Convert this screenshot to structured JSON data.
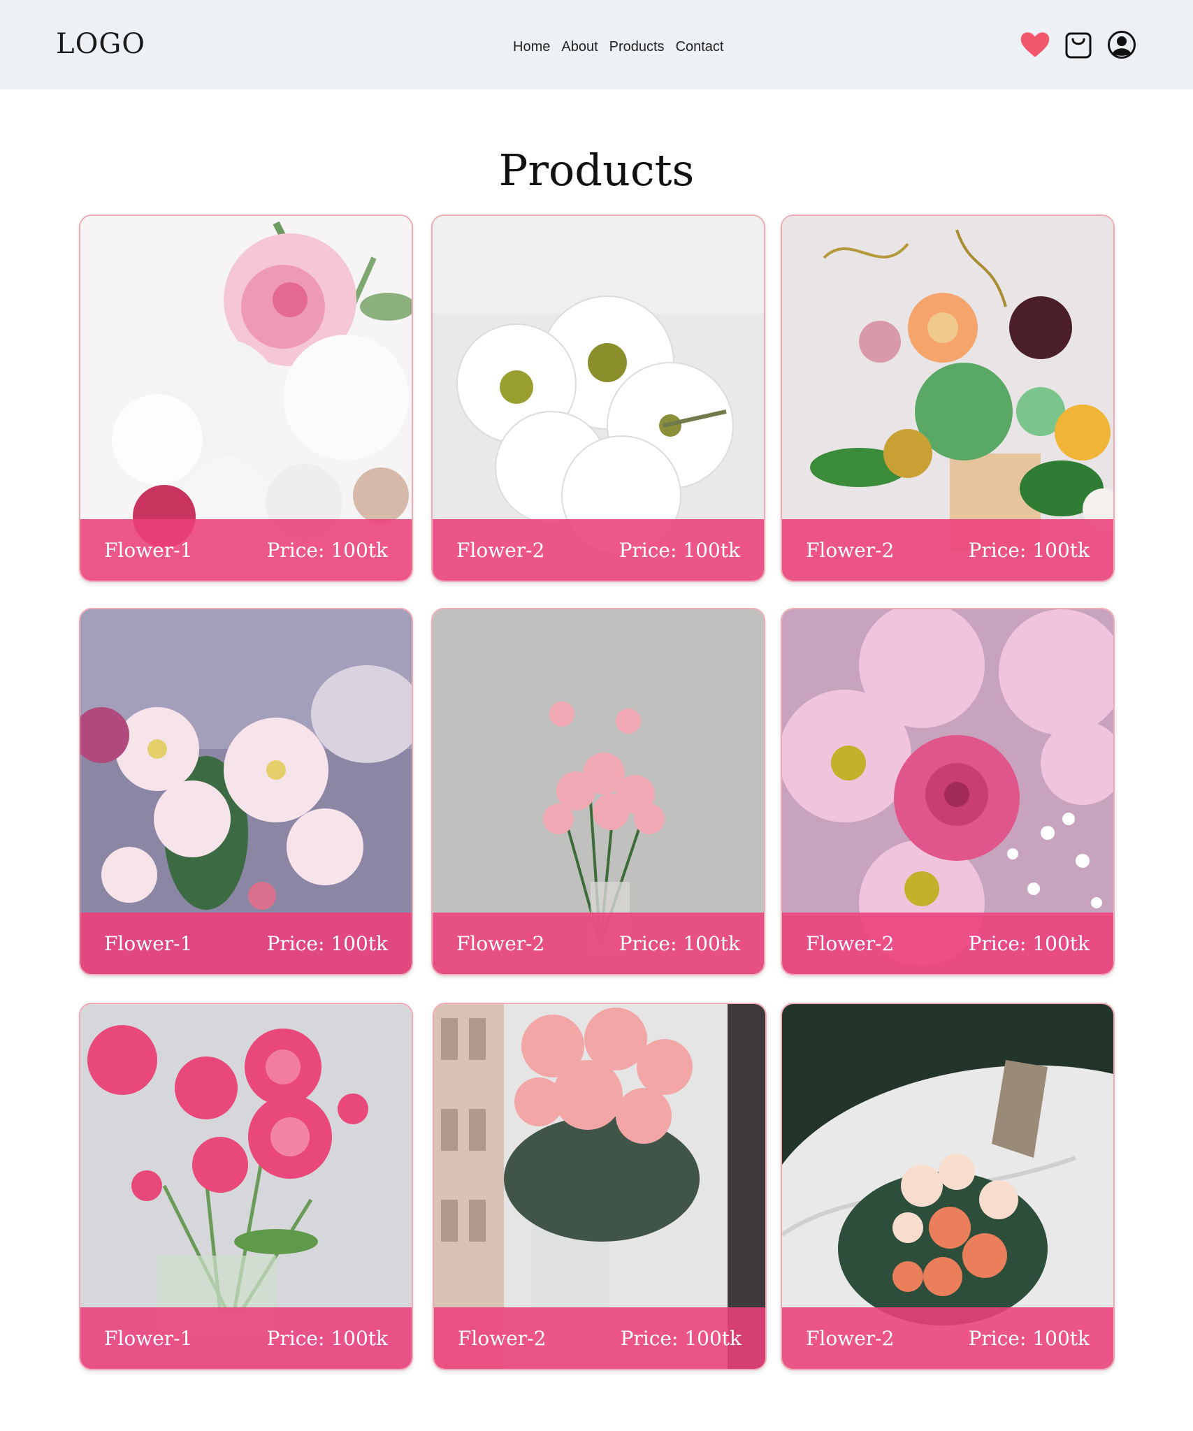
{
  "header": {
    "logo": "LOGO",
    "nav": [
      "Home",
      "About",
      "Products",
      "Contact"
    ],
    "icons": [
      "heart-icon",
      "shopping-bag-icon",
      "user-icon"
    ]
  },
  "page_title": "Products",
  "colors": {
    "accent": "#ec407a",
    "header_bg": "#eef1f4",
    "heart": "#f2566b",
    "card_border": "#f2aab6"
  },
  "products": [
    {
      "name": "Flower-1",
      "price": "Price: 100tk"
    },
    {
      "name": "Flower-2",
      "price": "Price: 100tk"
    },
    {
      "name": "Flower-2",
      "price": "Price: 100tk"
    },
    {
      "name": "Flower-1",
      "price": "Price: 100tk"
    },
    {
      "name": "Flower-2",
      "price": "Price: 100tk"
    },
    {
      "name": "Flower-2",
      "price": "Price: 100tk"
    },
    {
      "name": "Flower-1",
      "price": "Price: 100tk"
    },
    {
      "name": "Flower-2",
      "price": "Price: 100tk"
    },
    {
      "name": "Flower-2",
      "price": "Price: 100tk"
    }
  ]
}
